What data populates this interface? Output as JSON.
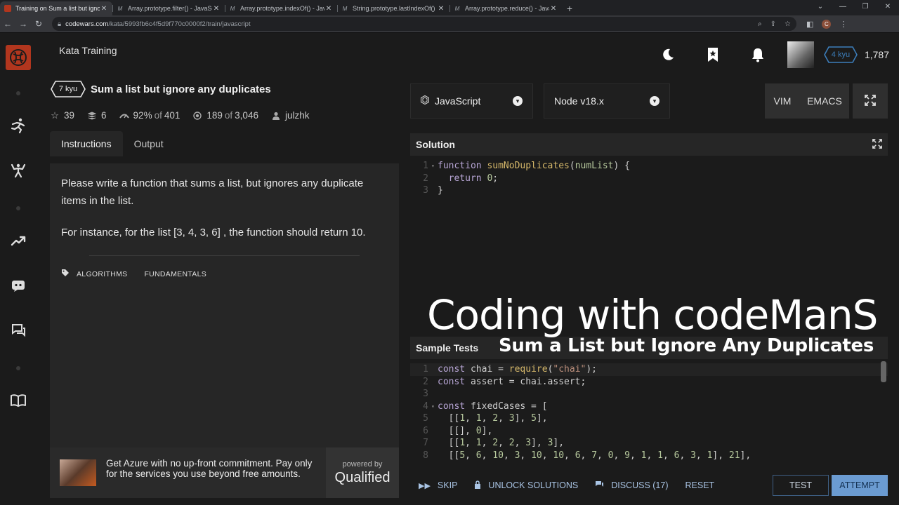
{
  "browser": {
    "tabs": [
      {
        "title": "Training on Sum a list but ignore",
        "active": true,
        "favicon": "codewars-icon"
      },
      {
        "title": "Array.prototype.filter() - JavaScript",
        "active": false,
        "favicon": "mdn-icon"
      },
      {
        "title": "Array.prototype.indexOf() - JavaS",
        "active": false,
        "favicon": "mdn-icon"
      },
      {
        "title": "String.prototype.lastIndexOf() - J",
        "active": false,
        "favicon": "mdn-icon"
      },
      {
        "title": "Array.prototype.reduce() - JavaSc",
        "active": false,
        "favicon": "mdn-icon"
      }
    ],
    "url_host": "codewars.com",
    "url_path": "/kata/5993fb6c4f5d9f770c0000f2/train/javascript",
    "profile_initial": "C"
  },
  "header": {
    "title": "Kata Training",
    "user_rank": "4 kyu",
    "honor": "1,787"
  },
  "kata": {
    "rank": "7 kyu",
    "title": "Sum a list but ignore any duplicates",
    "stars": "39",
    "collections": "6",
    "satisfaction": "92%",
    "satisfaction_of": "of",
    "satisfaction_total": "401",
    "completed": "189",
    "completed_of": "of",
    "completed_total": "3,046",
    "author": "julzhk"
  },
  "tabs": {
    "instructions": "Instructions",
    "output": "Output"
  },
  "instructions": {
    "p1": "Please write a function that sums a list, but ignores any duplicate items in the list.",
    "p2": "For instance, for the list [3, 4, 3, 6] , the function should return 10.",
    "tags": [
      "ALGORITHMS",
      "FUNDAMENTALS"
    ]
  },
  "ad": {
    "text": "Get Azure with no up-front commitment. Pay only for the services you use beyond free amounts.",
    "powered_by": "powered by",
    "brand": "Qualified"
  },
  "editor": {
    "language": "JavaScript",
    "runtime": "Node v18.x",
    "vim": "VIM",
    "emacs": "EMACS",
    "solution_label": "Solution",
    "sample_tests_label": "Sample Tests"
  },
  "overlay": {
    "title": "Coding with codeManS",
    "subtitle": "Sum a List but Ignore Any Duplicates"
  },
  "actions": {
    "skip": "SKIP",
    "unlock": "UNLOCK SOLUTIONS",
    "discuss": "DISCUSS (17)",
    "reset": "RESET",
    "test": "TEST",
    "attempt": "ATTEMPT"
  },
  "colors": {
    "codewars_red": "#b1361e",
    "attempt_blue": "#6b9bd1",
    "rank_blue": "#3c7ebb"
  }
}
